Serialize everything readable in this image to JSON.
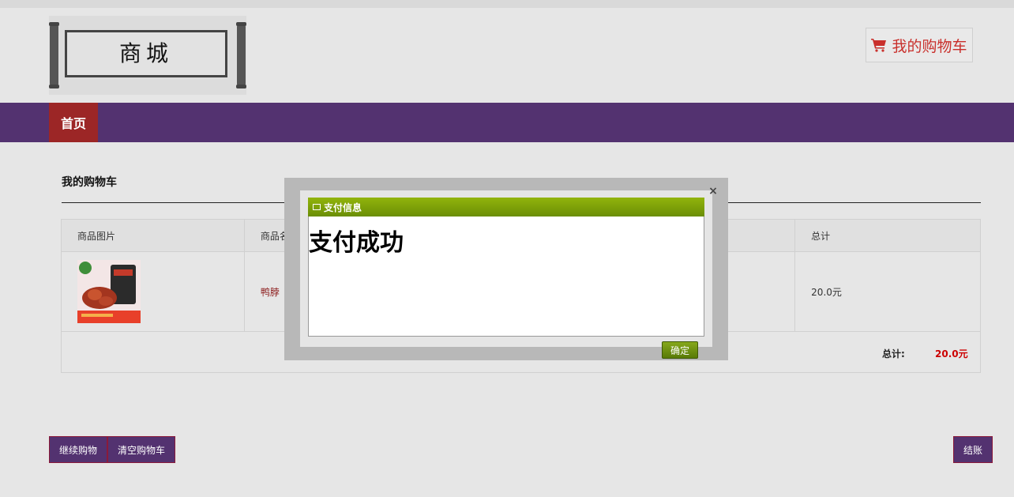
{
  "logo": {
    "text": "商城"
  },
  "header": {
    "cart_button_label": "我的购物车"
  },
  "nav": {
    "home_label": "首页"
  },
  "cart": {
    "title": "我的购物车",
    "columns": [
      "商品图片",
      "商品名称",
      "总计"
    ],
    "items": [
      {
        "name": "鸭脖",
        "total": "20.0元"
      }
    ],
    "total_label": "总计:",
    "total_value": "20.0元"
  },
  "actions": {
    "continue_label": "继续购物",
    "clear_label": "清空购物车",
    "checkout_label": "结账"
  },
  "modal": {
    "title": "支付信息",
    "message": "支付成功",
    "ok_label": "确定",
    "close_symbol": "×"
  },
  "colors": {
    "nav_bg": "#533270",
    "nav_active": "#9c2626",
    "accent_red": "#c9302c",
    "modal_header": "#7fa10a"
  }
}
